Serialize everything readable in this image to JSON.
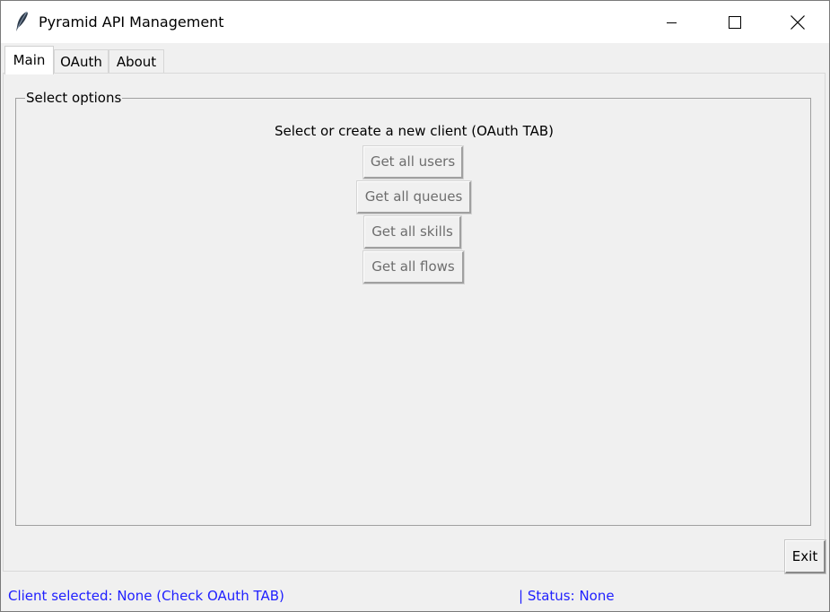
{
  "window": {
    "title": "Pyramid API Management",
    "app_icon": "feather-icon",
    "controls": {
      "minimize_icon": "minimize-icon",
      "maximize_icon": "maximize-icon",
      "close_icon": "close-icon"
    }
  },
  "tabs": [
    {
      "label": "Main",
      "active": true
    },
    {
      "label": "OAuth",
      "active": false
    },
    {
      "label": "About",
      "active": false
    }
  ],
  "main": {
    "group_title": "Select options",
    "instruction": "Select or create a new client (OAuth TAB)",
    "buttons": [
      {
        "label": "Get all users",
        "enabled": false
      },
      {
        "label": "Get all queues",
        "enabled": false
      },
      {
        "label": "Get all skills",
        "enabled": false
      },
      {
        "label": "Get all flows",
        "enabled": false
      }
    ],
    "exit_label": "Exit"
  },
  "status": {
    "client": "Client selected: None (Check OAuth TAB)",
    "status": "| Status: None",
    "color": "#1f1fff"
  }
}
